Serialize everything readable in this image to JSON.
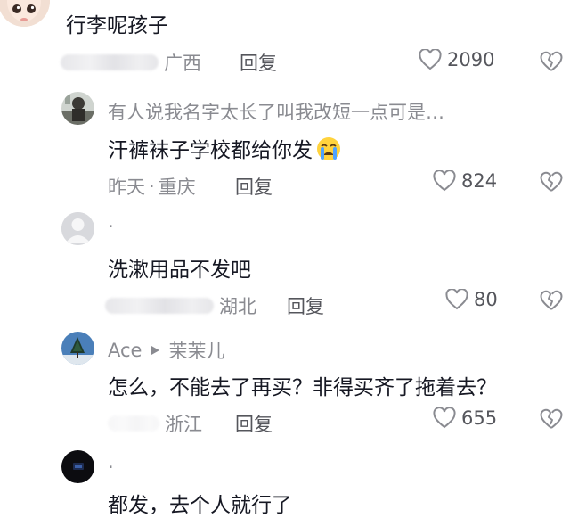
{
  "comments": [
    {
      "text": "行李呢孩子",
      "location": "广西",
      "reply_label": "回复",
      "likes": "2090"
    },
    {
      "username": "有人说我名字太长了叫我改短一点可是…",
      "text": "汗裤袜子学校都给你发",
      "emoji": "crying-face",
      "time": "昨天",
      "separator": "·",
      "location": "重庆",
      "reply_label": "回复",
      "likes": "824"
    },
    {
      "username": ".",
      "text": "洗漱用品不发吧",
      "location": "湖北",
      "reply_label": "回复",
      "likes": "80"
    },
    {
      "username": "Ace",
      "reply_to": "茉茉儿",
      "text": "怎么，不能去了再买？非得买齐了拖着去？",
      "location": "浙江",
      "reply_label": "回复",
      "likes": "655"
    },
    {
      "username": ".",
      "text": "都发，去个人就行了"
    }
  ],
  "icons": {
    "like": "heart-outline-icon",
    "dislike": "broken-heart-outline-icon",
    "reply_arrow": "play-triangle-icon"
  },
  "colors": {
    "text": "#161823",
    "secondary": "#8a8b91",
    "icon": "#8a8b91"
  }
}
